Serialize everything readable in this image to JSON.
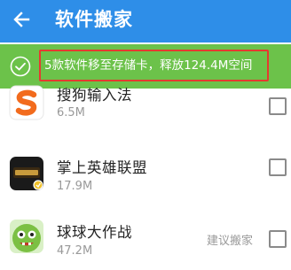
{
  "header": {
    "back_icon": "arrow-left-icon",
    "title": "软件搬家",
    "background": "#2e8ee8"
  },
  "banner": {
    "icon": "check-circle-icon",
    "message": "5款软件移至存储卡，释放124.4M空间",
    "background": "#6cc24a",
    "highlight_border": "#e53a2f"
  },
  "apps": [
    {
      "name": "搜狗输入法",
      "size": "6.5M",
      "icon": "sogou-input-app-icon",
      "checked": false
    },
    {
      "name": "掌上英雄联盟",
      "size": "17.9M",
      "icon": "lol-app-icon",
      "checked": false
    },
    {
      "name": "球球大作战",
      "size": "47.2M",
      "suggestion": "建议搬家",
      "icon": "ball-battle-app-icon",
      "checked": false
    }
  ]
}
